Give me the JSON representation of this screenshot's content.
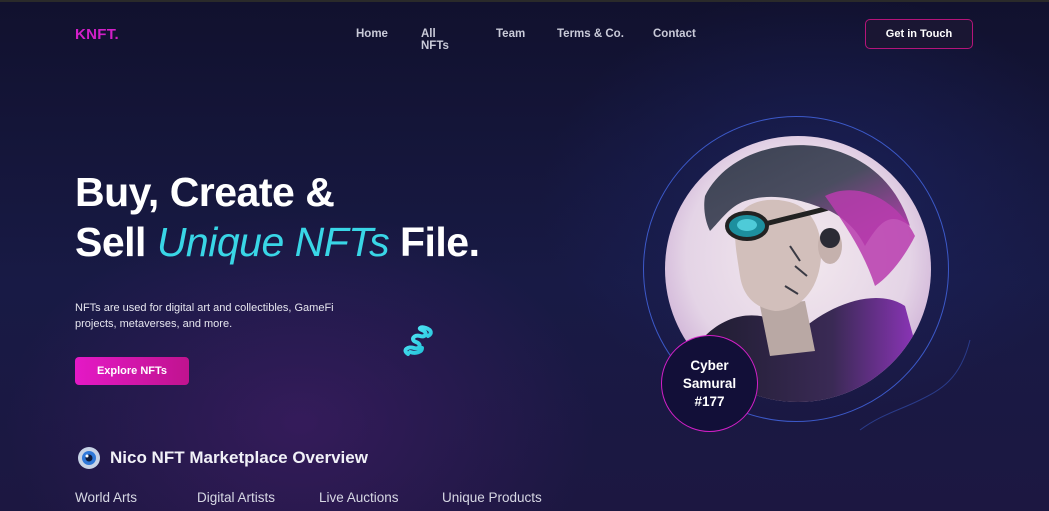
{
  "header": {
    "logo": "KNFT.",
    "nav": [
      "Home",
      "All NFTs",
      "Team",
      "Terms & Co.",
      "Contact"
    ],
    "cta": "Get in Touch"
  },
  "hero": {
    "title_line1": "Buy, Create &",
    "title_line2_pre": "Sell ",
    "title_line2_accent": "Unique NFTs",
    "title_line2_post": " File.",
    "description": "NFTs are used for digital art and collectibles, GameFi projects, metaverses, and more.",
    "button": "Explore NFTs"
  },
  "featured": {
    "badge_line1": "Cyber",
    "badge_line2": "Samural",
    "badge_line3": "#177"
  },
  "overview": {
    "title": "Nico NFT Marketplace Overview",
    "stats": [
      "World Arts",
      "Digital Artists",
      "Live Auctions",
      "Unique Products"
    ]
  },
  "colors": {
    "brand": "#d21fc8",
    "accent": "#39d6e6",
    "background": "#15153a",
    "ring": "#3c59c9"
  },
  "icons": [
    "spring-icon",
    "eye-icon",
    "portrait-image"
  ]
}
